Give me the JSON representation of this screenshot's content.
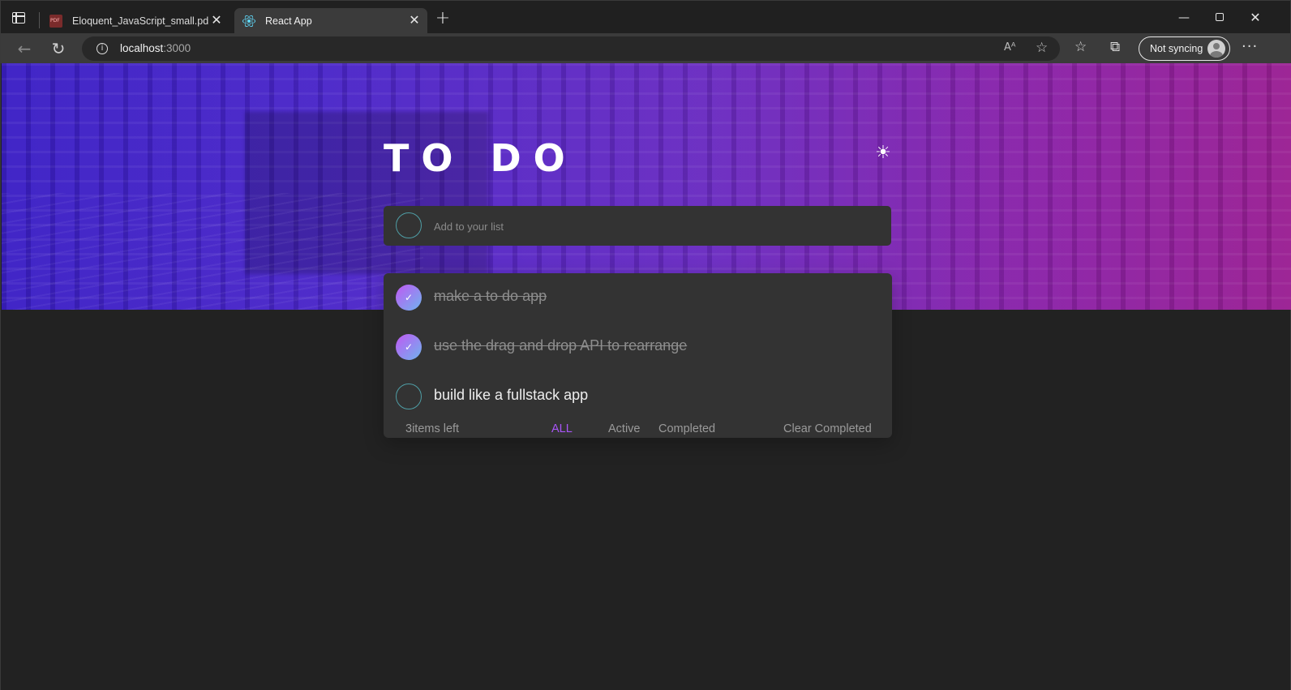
{
  "browser": {
    "tabs": [
      {
        "title": "Eloquent_JavaScript_small.pdf",
        "icon": "pdf-icon",
        "active": false
      },
      {
        "title": "React App",
        "icon": "react-icon",
        "active": true
      }
    ],
    "new_tab_symbol": "+",
    "close_symbol": "✕",
    "url_host": "localhost",
    "url_port": ":3000",
    "profile_label": "Not syncing",
    "window_controls": {
      "minimize": "—",
      "close": "✕"
    }
  },
  "app": {
    "title": "TO DO",
    "theme_icon": "sun-icon",
    "new_todo_placeholder": "Add to your list",
    "todos": [
      {
        "text": "make a to do app",
        "completed": true
      },
      {
        "text": "use the drag and drop API to rearrange",
        "completed": true
      },
      {
        "text": "build like a fullstack app",
        "completed": false
      }
    ],
    "footer": {
      "items_left": "3items left",
      "filters": [
        "ALL",
        "Active",
        "Completed"
      ],
      "active_filter": "ALL",
      "clear_label": "Clear Completed"
    },
    "colors": {
      "accent": "#a855f7",
      "check_gradient_start": "#c058f3",
      "check_gradient_end": "#6fb4ef",
      "page_background": "#222222",
      "card_background": "#333333"
    }
  }
}
